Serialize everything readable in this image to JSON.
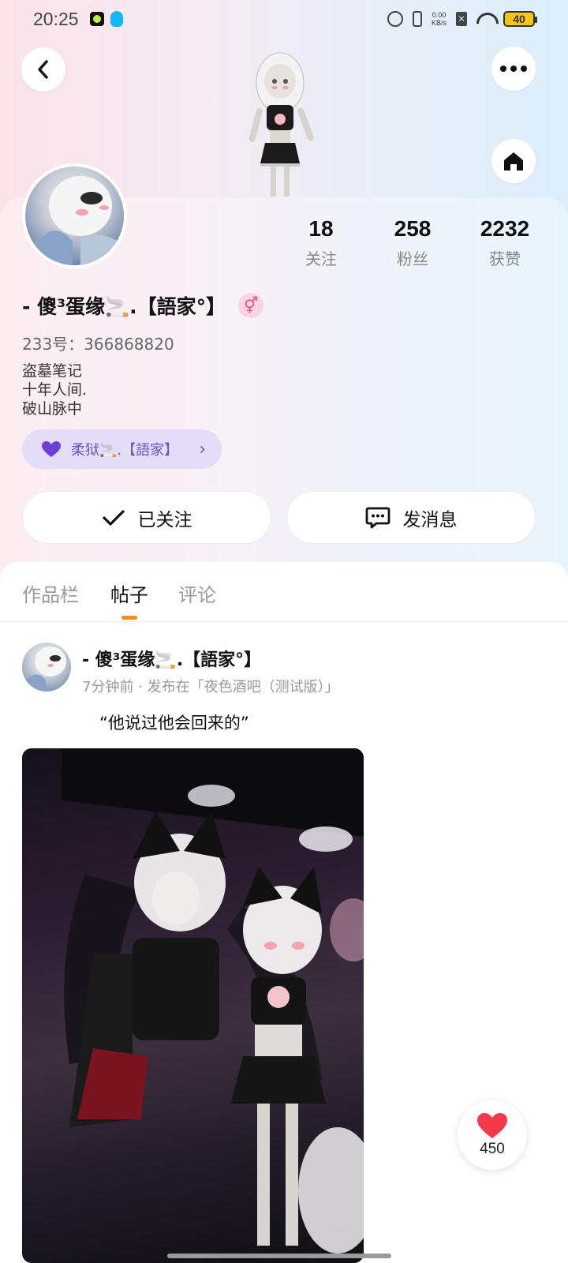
{
  "status_bar": {
    "time": "20:25",
    "net_speed_value": "0.00",
    "net_speed_unit": "KB/s",
    "battery": "40"
  },
  "profile": {
    "stats": [
      {
        "value": "18",
        "label": "关注"
      },
      {
        "value": "258",
        "label": "粉丝"
      },
      {
        "value": "2232",
        "label": "获赞"
      }
    ],
    "username": "- 傻³蛋缘🚬.【語家°】",
    "gender_symbol": "⚥",
    "uid": "233号：366868820",
    "bio": "盗墓笔记\n十年人间.\n破山脉中",
    "club_name": "柔狱🚬.【語家】",
    "club_arrow": "›"
  },
  "actions": {
    "follow_label": "已关注",
    "message_label": "发消息"
  },
  "tabs": [
    {
      "label": "作品栏",
      "active": false
    },
    {
      "label": "帖子",
      "active": true
    },
    {
      "label": "评论",
      "active": false
    }
  ],
  "post": {
    "author": "- 傻³蛋缘🚬.【語家°】",
    "meta": "7分钟前 · 发布在「夜色酒吧（测试版）」",
    "text": "“他说过他会回来的”",
    "like_count": "450"
  },
  "colors": {
    "accent_orange": "#f28c28",
    "club_purple": "#6d53c9",
    "like_red": "#f23a4a"
  }
}
